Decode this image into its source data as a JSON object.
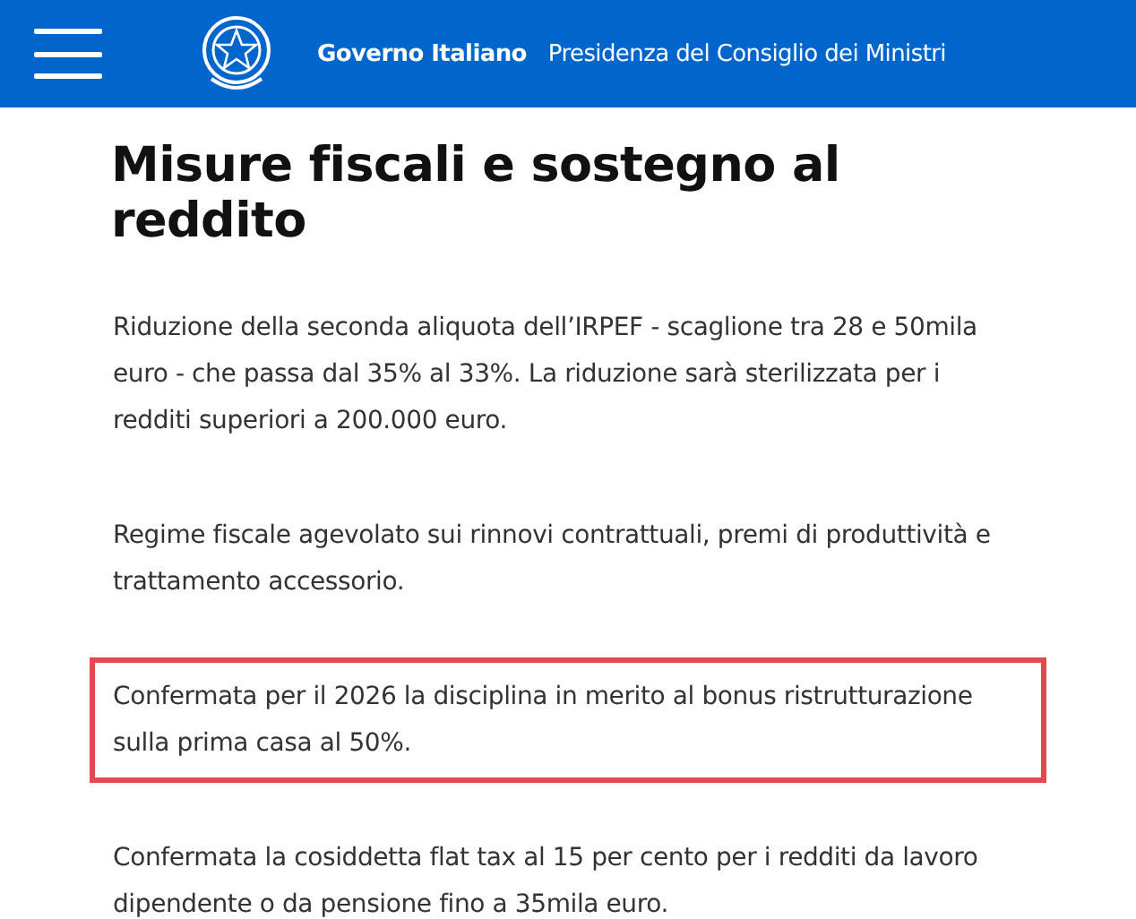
{
  "header": {
    "brand": "Governo Italiano",
    "subtitle": "Presidenza del Consiglio dei Ministri"
  },
  "title": "Misure fiscali e sostegno al reddito",
  "paragraphs": [
    {
      "text": "Riduzione della seconda aliquota dell’IRPEF - scaglione tra 28 e 50mila euro - che passa dal 35% al 33%. La riduzione sarà sterilizzata per i redditi superiori a 200.000 euro.",
      "highlighted": false
    },
    {
      "text": "Regime fiscale agevolato sui rinnovi contrattuali, premi di produttività e trattamento accessorio.",
      "highlighted": false
    },
    {
      "text": "Confermata per il 2026 la disciplina in merito al bonus ristrutturazione sulla prima casa al 50%.",
      "highlighted": true
    },
    {
      "text": "Confermata la cosiddetta flat tax al 15 per cento per i redditi da lavoro dipendente o da pensione fino a 35mila euro.",
      "highlighted": false
    }
  ]
}
